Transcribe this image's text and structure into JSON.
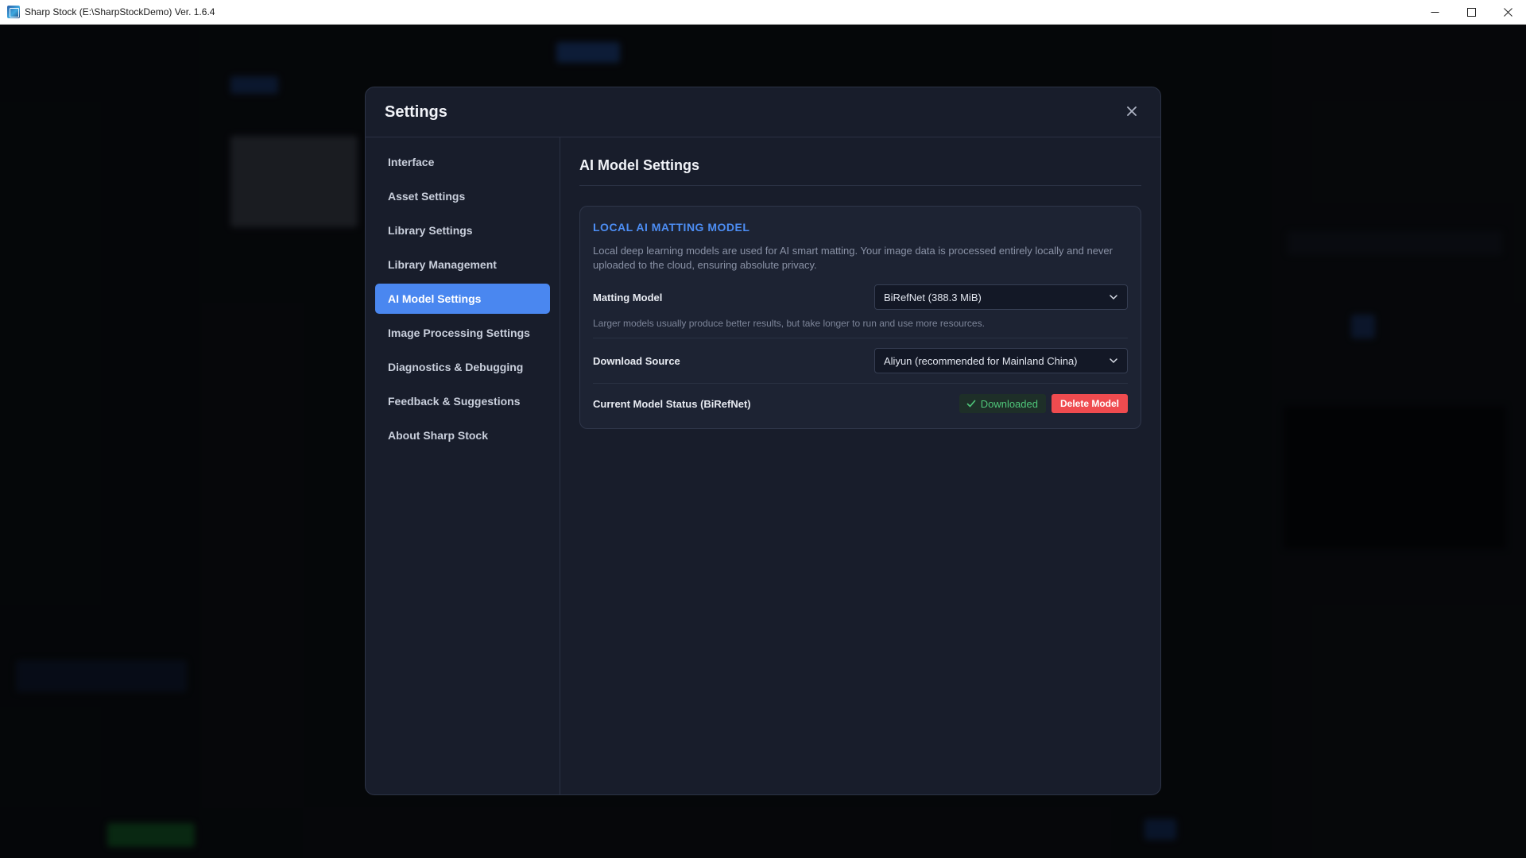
{
  "window": {
    "title": "Sharp Stock (E:\\SharpStockDemo) Ver. 1.6.4",
    "controls": {
      "minimize": "—",
      "maximize": "☐",
      "close": "✕"
    }
  },
  "modal": {
    "title": "Settings",
    "close_glyph": "✕"
  },
  "nav": {
    "items": [
      {
        "label": "Interface",
        "active": false
      },
      {
        "label": "Asset Settings",
        "active": false
      },
      {
        "label": "Library Settings",
        "active": false
      },
      {
        "label": "Library Management",
        "active": false
      },
      {
        "label": "AI Model Settings",
        "active": true
      },
      {
        "label": "Image Processing Settings",
        "active": false
      },
      {
        "label": "Diagnostics & Debugging",
        "active": false
      },
      {
        "label": "Feedback & Suggestions",
        "active": false
      },
      {
        "label": "About Sharp Stock",
        "active": false
      }
    ]
  },
  "content": {
    "title": "AI Model Settings",
    "card": {
      "title": "LOCAL AI MATTING MODEL",
      "description": "Local deep learning models are used for AI smart matting. Your image data is processed entirely locally and never uploaded to the cloud, ensuring absolute privacy.",
      "matting_model": {
        "label": "Matting Model",
        "value": "BiRefNet (388.3 MiB)",
        "hint": "Larger models usually produce better results, but take longer to run and use more resources."
      },
      "download_source": {
        "label": "Download Source",
        "value": "Aliyun (recommended for Mainland China)"
      },
      "status": {
        "label": "Current Model Status (BiRefNet)",
        "badge": "Downloaded",
        "delete_button": "Delete Model"
      }
    }
  },
  "colors": {
    "accent": "#4a87f0",
    "card_title": "#4d8ef5",
    "success": "#4fc67a",
    "danger": "#ef4b4f"
  }
}
